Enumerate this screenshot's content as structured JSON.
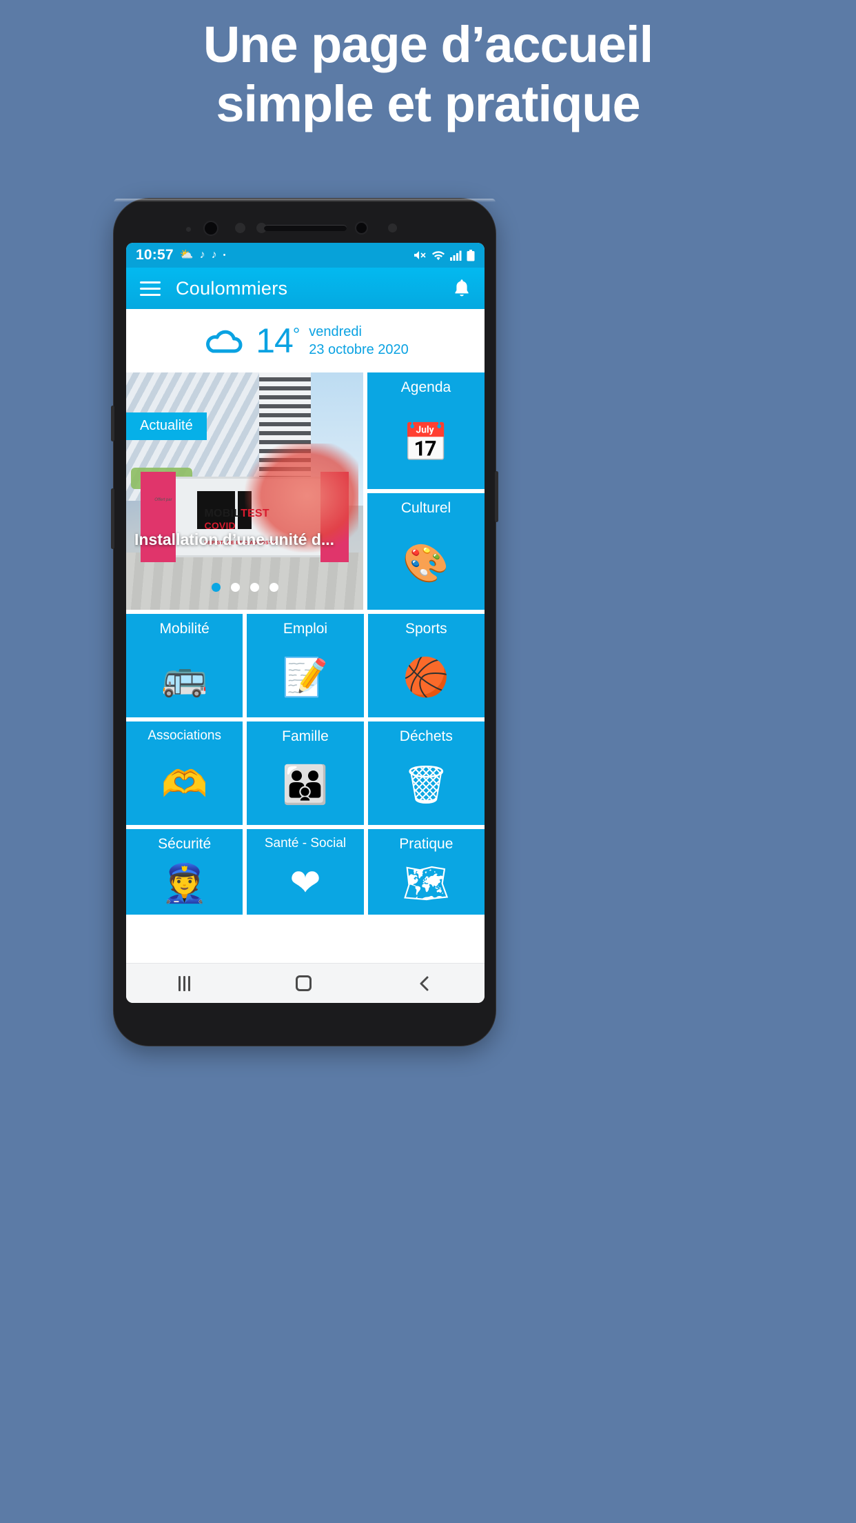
{
  "promo": {
    "line1": "Une page d’accueil",
    "line2": "simple et pratique"
  },
  "colors": {
    "background": "#5c7ba6",
    "accent": "#0aa6e3",
    "appbar": "#04a9e0",
    "statusbar": "#07a2d9",
    "tile": "#0aa6e3",
    "weather_text": "#0aa2e2"
  },
  "status_bar": {
    "time": "10:57",
    "left_icons": [
      "weather-icon",
      "music-note-icon",
      "music-note-icon",
      "dot-icon"
    ],
    "right_icons": [
      "mute-icon",
      "wifi-icon",
      "signal-icon",
      "battery-icon"
    ]
  },
  "app_bar": {
    "menu_icon": "hamburger-icon",
    "title": "Coulommiers",
    "notification_icon": "bell-icon"
  },
  "weather": {
    "icon": "cloud-icon",
    "temperature": "14",
    "degree_symbol": "°",
    "day": "vendredi",
    "date": "23 octobre 2020"
  },
  "news_card": {
    "badge": "Actualité",
    "title": "Installation d’une unité d...",
    "banner_text_main": "MOBIL",
    "banner_text_bold": "TEST",
    "banner_text_sub": "COVID",
    "banner_caption": "DÉPISTAGE ET DIAGNOSTIC",
    "banner_credit": "Offert par",
    "carousel_dots": 4,
    "active_dot": 1
  },
  "tiles": {
    "side": [
      {
        "label": "Agenda",
        "icon": "calendar-icon",
        "glyph": "📅"
      },
      {
        "label": "Culturel",
        "icon": "palette-icon",
        "glyph": "🎨"
      }
    ],
    "grid": [
      {
        "label": "Mobilité",
        "icon": "bus-icon",
        "glyph": "🚌"
      },
      {
        "label": "Emploi",
        "icon": "cv-document-icon",
        "glyph": "📝"
      },
      {
        "label": "Sports",
        "icon": "basketball-icon",
        "glyph": "🏀"
      },
      {
        "label": "Associations",
        "icon": "hands-heart-icon",
        "glyph": "🫶"
      },
      {
        "label": "Famille",
        "icon": "family-icon",
        "glyph": "👪"
      },
      {
        "label": "Déchets",
        "icon": "trash-bin-icon",
        "glyph": "🗑"
      },
      {
        "label": "Sécurité",
        "icon": "police-officer-icon",
        "glyph": "👮"
      },
      {
        "label": "Santé - Social",
        "icon": "heart-pulse-icon",
        "glyph": "❤"
      },
      {
        "label": "Pratique",
        "icon": "map-pin-icon",
        "glyph": "🗺"
      }
    ]
  },
  "nav_bar": {
    "recents": "recents-icon",
    "home": "home-icon",
    "back": "back-icon"
  }
}
